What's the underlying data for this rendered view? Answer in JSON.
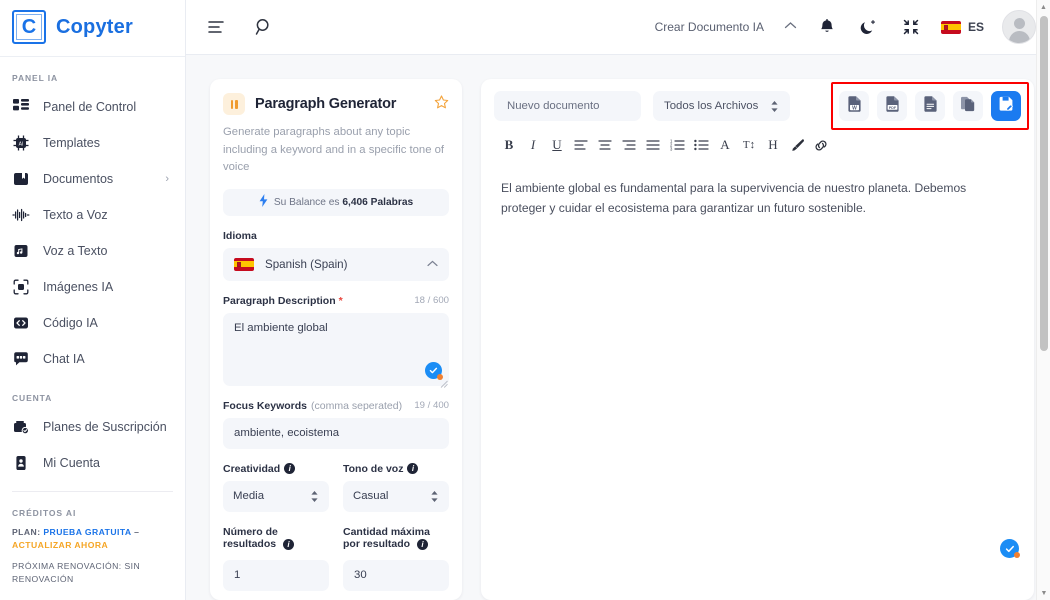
{
  "brand": {
    "mark": "C",
    "name": "Copyter"
  },
  "sidebar": {
    "group_panel_label": "PANEL IA",
    "items": [
      {
        "label": "Panel de Control",
        "icon": "dashboard-icon"
      },
      {
        "label": "Templates",
        "icon": "chip-ai-icon"
      },
      {
        "label": "Documentos",
        "icon": "documents-icon",
        "caret": "›"
      },
      {
        "label": "Texto a Voz",
        "icon": "waveform-icon"
      },
      {
        "label": "Voz a Texto",
        "icon": "audio-file-icon"
      },
      {
        "label": "Imágenes IA",
        "icon": "image-ai-icon"
      },
      {
        "label": "Código IA",
        "icon": "code-icon"
      },
      {
        "label": "Chat IA",
        "icon": "chat-icon"
      }
    ],
    "group_account_label": "CUENTA",
    "account_items": [
      {
        "label": "Planes de Suscripción",
        "icon": "subscription-icon"
      },
      {
        "label": "Mi Cuenta",
        "icon": "account-icon"
      }
    ],
    "group_credits_label": "CRÉDITOS AI",
    "plan_prefix": "PLAN:",
    "plan_value": "PRUEBA GRATUITA",
    "plan_dash": "–",
    "plan_upgrade": "ACTUALIZAR AHORA",
    "renewal": "PRÓXIMA RENOVACIÓN: SIN RENOVACIÓN"
  },
  "topbar": {
    "menu_icon": "menu-icon",
    "search_icon": "search-icon",
    "create_document": "Crear Documento IA",
    "chevron": "⌃",
    "bell_icon": "bell-icon",
    "moon_icon": "dark-mode-icon",
    "fullscreen_icon": "fullscreen-icon",
    "lang_code": "ES",
    "avatar": "user-avatar"
  },
  "form": {
    "title": "Paragraph Generator",
    "description": "Generate paragraphs about any topic including a keyword and in a specific tone of voice",
    "balance_bolt": "⚡",
    "balance_prefix": "Su Balance es ",
    "balance_value": "6,406 Palabras",
    "language_label": "Idioma",
    "language_value": "Spanish (Spain)",
    "paragraph_label": "Paragraph Description",
    "paragraph_required": "*",
    "paragraph_counter": "18 / 600",
    "paragraph_value": "El ambiente global",
    "keywords_label": "Focus Keywords",
    "keywords_hint": "(comma seperated)",
    "keywords_counter": "19 / 400",
    "keywords_value": "ambiente, ecoistema",
    "creativity_label": "Creatividad",
    "creativity_value": "Media",
    "tone_label": "Tono de voz",
    "tone_value": "Casual",
    "results_label": "Número de resultados",
    "results_value": "1",
    "max_label": "Cantidad máxima por resultado",
    "max_value": "30"
  },
  "editor": {
    "doc_name": "Nuevo documento",
    "file_filter": "Todos los Archivos",
    "export_buttons": [
      {
        "name": "export-word-button",
        "icon": "word-file-icon"
      },
      {
        "name": "export-pdf-button",
        "icon": "pdf-file-icon"
      },
      {
        "name": "export-text-button",
        "icon": "text-file-icon"
      },
      {
        "name": "copy-document-button",
        "icon": "copy-icon"
      },
      {
        "name": "save-document-button",
        "icon": "save-document-icon"
      }
    ],
    "format_buttons": [
      {
        "label": "B",
        "name": "bold-button"
      },
      {
        "label": "I",
        "name": "italic-button"
      },
      {
        "label": "U",
        "name": "underline-button"
      },
      {
        "label": "",
        "name": "align-left-button"
      },
      {
        "label": "",
        "name": "align-center-button"
      },
      {
        "label": "",
        "name": "align-right-button"
      },
      {
        "label": "",
        "name": "align-justify-button"
      },
      {
        "label": "",
        "name": "ordered-list-button"
      },
      {
        "label": "",
        "name": "unordered-list-button"
      },
      {
        "label": "A",
        "name": "font-color-button"
      },
      {
        "label": "T↕",
        "name": "font-size-button"
      },
      {
        "label": "H",
        "name": "heading-button"
      },
      {
        "label": "",
        "name": "brush-button"
      },
      {
        "label": "",
        "name": "link-button"
      }
    ],
    "body_text": "El ambiente global es fundamental para la supervivencia de nuestro planeta. Debemos proteger y cuidar el ecosistema para garantizar un futuro sostenible."
  },
  "colors": {
    "brand_blue": "#1a6fe0",
    "primary_blue": "#1b7bf0",
    "accent_orange": "#f3a33c",
    "highlight_red": "#fb0000",
    "required_red": "#e8453c",
    "panel_bg": "#f7f8fa",
    "field_bg": "#f4f6fa"
  }
}
